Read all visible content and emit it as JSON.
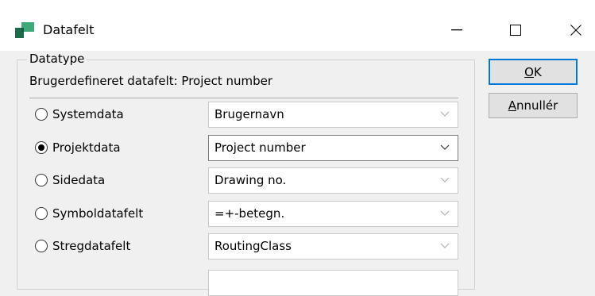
{
  "window": {
    "title": "Datafelt",
    "minimize_label": "—",
    "close_label": "×"
  },
  "group": {
    "legend": "Datatype",
    "subtitle": "Brugerdefineret datafelt: Project number"
  },
  "rows": [
    {
      "label": "Systemdata",
      "value": "Brugernavn",
      "checked": false
    },
    {
      "label": "Projektdata",
      "value": "Project number",
      "checked": true
    },
    {
      "label": "Sidedata",
      "value": "Drawing no.",
      "checked": false
    },
    {
      "label": "Symboldatafelt",
      "value": "=+-betegn.",
      "checked": false
    },
    {
      "label": "Stregdatafelt",
      "value": "RoutingClass",
      "checked": false
    }
  ],
  "buttons": {
    "ok": {
      "mnemonic": "O",
      "rest": "K"
    },
    "cancel": {
      "mnemonic": "A",
      "rest": "nnullér"
    }
  },
  "colors": {
    "focus_border": "#0078d7",
    "icon_dark": "#1e6b4c",
    "icon_light": "#3fa878"
  }
}
